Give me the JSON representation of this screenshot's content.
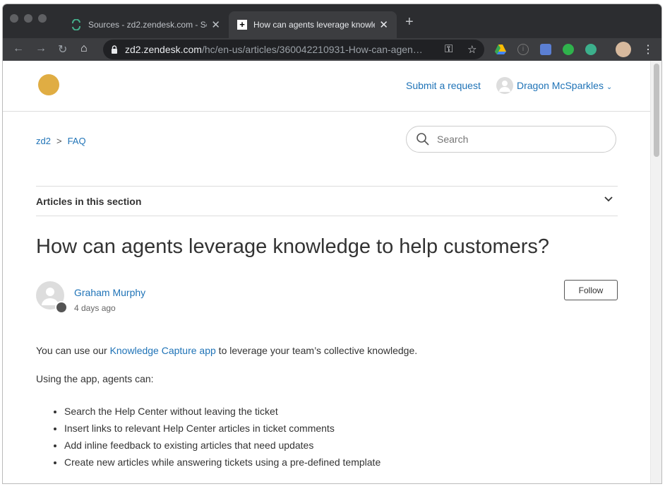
{
  "browser": {
    "tabs": [
      {
        "title": "Sources - zd2.zendesk.com - Se",
        "active": false
      },
      {
        "title": "How can agents leverage knowle",
        "active": true
      }
    ],
    "url_host": "zd2.zendesk.com",
    "url_path": "/hc/en-us/articles/360042210931-How-can-agen…"
  },
  "header": {
    "submit_request": "Submit a request",
    "user_name": "Dragon McSparkles"
  },
  "breadcrumb": {
    "items": [
      "zd2",
      "FAQ"
    ],
    "separator": ">"
  },
  "search": {
    "placeholder": "Search"
  },
  "section": {
    "label": "Articles in this section"
  },
  "article": {
    "title": "How can agents leverage knowledge to help customers?",
    "author": "Graham Murphy",
    "date": "4 days ago",
    "follow_label": "Follow",
    "intro_before": "You can use our ",
    "intro_link": "Knowledge Capture app",
    "intro_after": " to leverage your team’s collective knowledge.",
    "using": "Using the app, agents can:",
    "bullets": [
      "Search the Help Center without leaving the ticket",
      "Insert links to relevant Help Center articles in ticket comments",
      "Add inline feedback to existing articles that need updates",
      "Create new articles while answering tickets using a pre-defined template"
    ]
  },
  "colors": {
    "link": "#1f73b7",
    "logo": "#e0ad43",
    "text": "#333333"
  }
}
